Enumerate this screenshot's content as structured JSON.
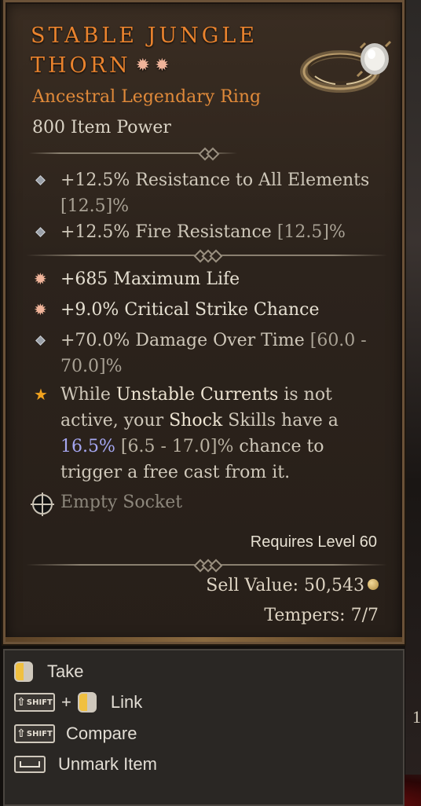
{
  "item": {
    "name": "Stable Jungle Thorn",
    "name_line1": "Stable Jungle",
    "name_line2": "Thorn",
    "marks": [
      "✹",
      "✹"
    ],
    "type": "Ancestral Legendary Ring",
    "item_power": "800 Item Power"
  },
  "implicit_stats": [
    {
      "main": "+12.5% Resistance to All Elements",
      "range": "[12.5]%"
    },
    {
      "main": "+12.5% Fire Resistance",
      "range": "[12.5]%"
    }
  ],
  "affixes": [
    {
      "text": "+685 Maximum Life",
      "icon": "greater-affix-icon"
    },
    {
      "text": "+9.0% Critical Strike Chance",
      "icon": "greater-affix-icon"
    },
    {
      "text": "+70.0% Damage Over Time",
      "range": "[60.0 - 70.0]%",
      "icon": "diamond-bullet-icon"
    }
  ],
  "legendary_aspect": {
    "p1": "While",
    "p2": "Unstable Currents",
    "p3": "is not active, your",
    "p4": "Shock",
    "p5": "Skills have a",
    "p6": "16.5%",
    "p7": "[6.5 - 17.0]%",
    "p8": "chance to trigger a free cast from it."
  },
  "socket": {
    "label": "Empty Socket"
  },
  "requirements": {
    "level": "Requires Level 60"
  },
  "sell_value": {
    "label": "Sell Value: 50,543"
  },
  "tempers": {
    "label": "Tempers: 7/7"
  },
  "actions": [
    {
      "label": "Take",
      "keys": [
        "mouse-left"
      ]
    },
    {
      "label": "Link",
      "keys": [
        "SHIFT",
        "mouse-left"
      ]
    },
    {
      "label": "Compare",
      "keys": [
        "SHIFT"
      ]
    },
    {
      "label": "Unmark Item",
      "keys": [
        "space"
      ]
    }
  ],
  "key_shift_label": "SHIFT",
  "plus": "+",
  "bg_side_text": "1",
  "colors": {
    "name": "#e9832e",
    "legendary": "#ec8c2c",
    "value_highlight": "#a5a6f0",
    "frame": "#6b5238"
  }
}
